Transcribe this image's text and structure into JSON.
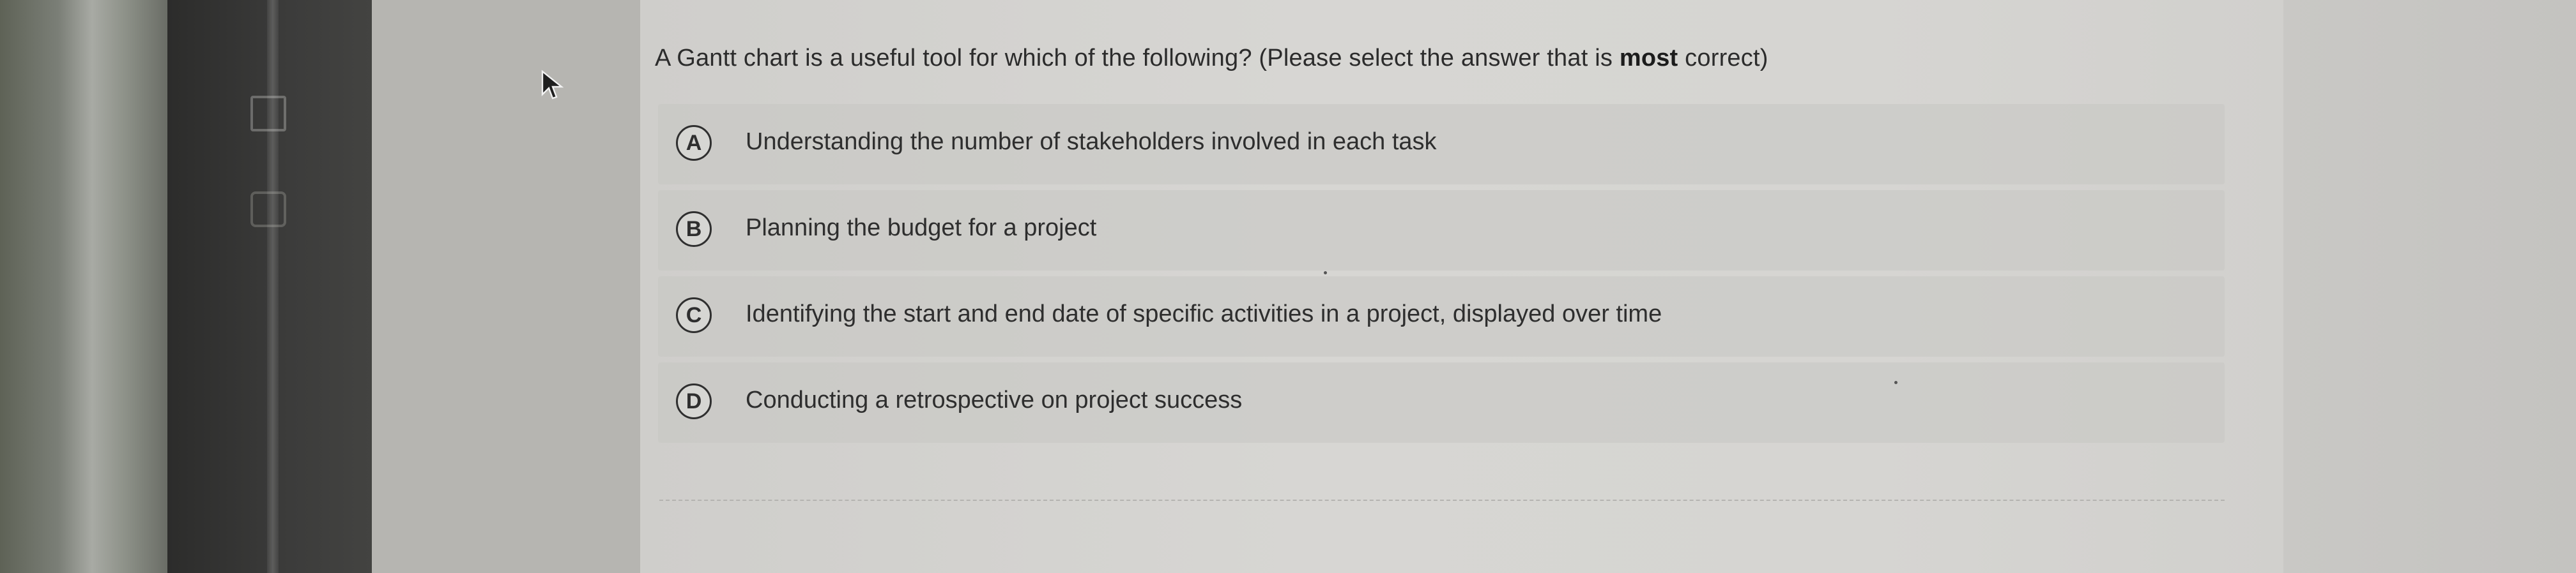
{
  "question": {
    "prefix": "A Gantt chart is a useful tool for which of the following? (Please select the answer that is ",
    "emphasis": "most",
    "suffix": " correct)"
  },
  "options": [
    {
      "letter": "A",
      "text": "Understanding the number of stakeholders involved in each task"
    },
    {
      "letter": "B",
      "text": "Planning the budget for a project"
    },
    {
      "letter": "C",
      "text": "Identifying the start and end date of specific activities in a project, displayed over time"
    },
    {
      "letter": "D",
      "text": "Conducting a retrospective on project success"
    }
  ],
  "icons": {
    "pointer": "mouse-pointer-icon"
  },
  "colors": {
    "text": "#2c2c2c",
    "option_background": "#c7c6c3",
    "page_background": "#d6d5d2"
  }
}
